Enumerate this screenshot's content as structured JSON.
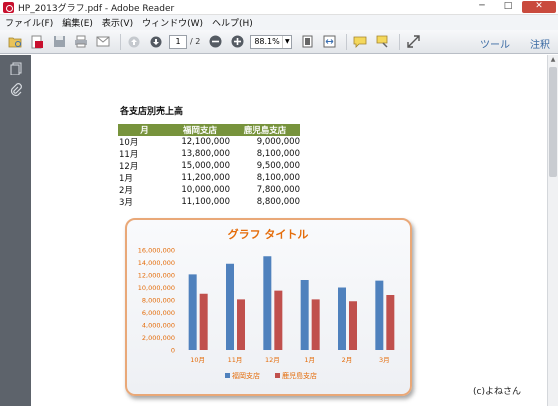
{
  "window": {
    "title": "HP_2013グラフ.pdf - Adobe Reader",
    "controls": [
      "─",
      "□",
      "✕"
    ]
  },
  "menu": {
    "items": [
      "ファイル(F)",
      "編集(E)",
      "表示(V)",
      "ウィンドウ(W)",
      "ヘルプ(H)"
    ]
  },
  "toolbar": {
    "page_current": "1",
    "page_total": "/ 2",
    "zoom": "88.1%",
    "tools_label": "ツール",
    "comment_label": "注釈"
  },
  "document": {
    "heading": "各支店別売上高",
    "table": {
      "headers": [
        "月",
        "福岡支店",
        "鹿児島支店"
      ],
      "rows": [
        [
          "10月",
          "12,100,000",
          "9,000,000"
        ],
        [
          "11月",
          "13,800,000",
          "8,100,000"
        ],
        [
          "12月",
          "15,000,000",
          "9,500,000"
        ],
        [
          "1月",
          "11,200,000",
          "8,100,000"
        ],
        [
          "2月",
          "10,000,000",
          "7,800,000"
        ],
        [
          "3月",
          "11,100,000",
          "8,800,000"
        ]
      ]
    },
    "copyright": "(c)よねさん"
  },
  "colors": {
    "fukuoka": "#4f81bd",
    "kagoshima": "#c0504d",
    "header_green": "#77933c",
    "chart_title": "#e46c0a"
  },
  "chart_data": {
    "type": "bar",
    "title": "グラフ タイトル",
    "categories": [
      "10月",
      "11月",
      "12月",
      "1月",
      "2月",
      "3月"
    ],
    "series": [
      {
        "name": "福岡支店",
        "values": [
          12100000,
          13800000,
          15000000,
          11200000,
          10000000,
          11100000
        ]
      },
      {
        "name": "鹿児島支店",
        "values": [
          9000000,
          8100000,
          9500000,
          8100000,
          7800000,
          8800000
        ]
      }
    ],
    "yticks": [
      "0",
      "2,000,000",
      "4,000,000",
      "6,000,000",
      "8,000,000",
      "10,000,000",
      "12,000,000",
      "14,000,000",
      "16,000,000"
    ],
    "ylim": [
      0,
      16000000
    ],
    "grid": false,
    "legend": "bottom"
  }
}
